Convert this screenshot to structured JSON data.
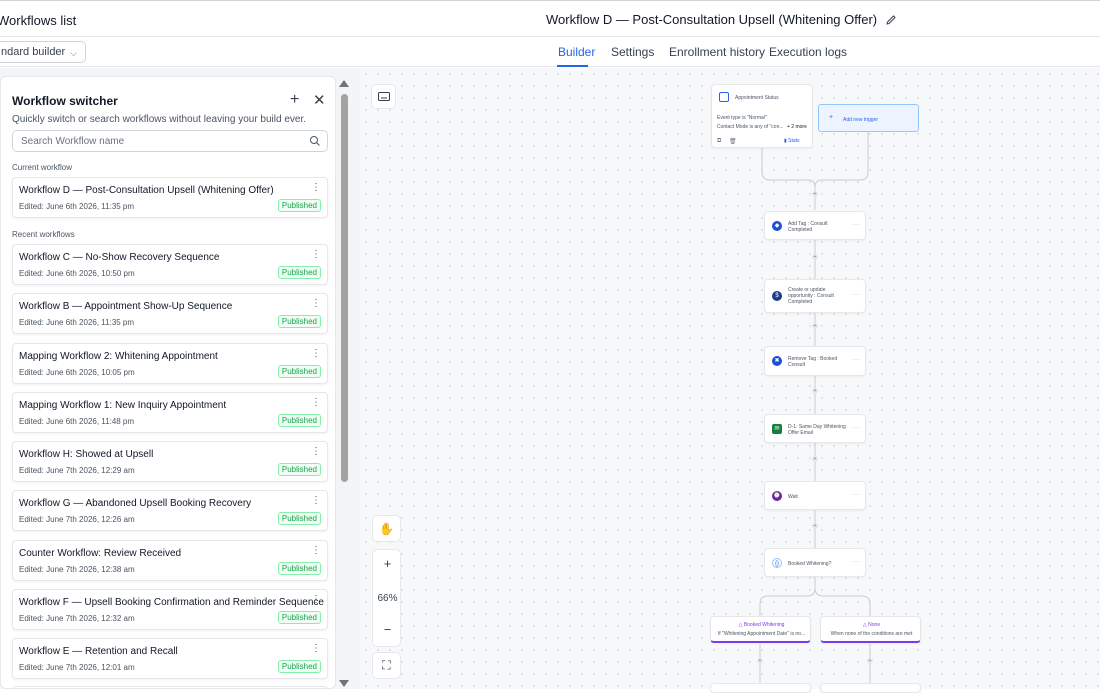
{
  "header": {
    "breadcrumb": "Workflows list",
    "title": "Workflow D — Post-Consultation Upsell (Whitening Offer)"
  },
  "builder_select": {
    "value": "ndard builder"
  },
  "tabs": [
    {
      "label": "Builder",
      "active": true
    },
    {
      "label": "Settings"
    },
    {
      "label": "Enrollment history"
    },
    {
      "label": "Execution logs"
    }
  ],
  "switcher": {
    "title": "Workflow switcher",
    "subtitle": "Quickly switch or search workflows without leaving your build ever.",
    "search_placeholder": "Search Workflow name",
    "current_label": "Current workflow",
    "recent_label": "Recent workflows",
    "current": {
      "name": "Workflow D — Post-Consultation Upsell (Whitening Offer)",
      "edited": "Edited: June 6th 2026, 11:35 pm",
      "status": "Published"
    },
    "recent": [
      {
        "name": "Workflow C — No-Show Recovery Sequence",
        "edited": "Edited: June 6th 2026, 10:50 pm",
        "status": "Published"
      },
      {
        "name": "Workflow B — Appointment Show-Up Sequence",
        "edited": "Edited: June 6th 2026, 11:35 pm",
        "status": "Published"
      },
      {
        "name": "Mapping Workflow 2: Whitening Appointment",
        "edited": "Edited: June 6th 2026, 10:05 pm",
        "status": "Published"
      },
      {
        "name": "Mapping Workflow 1: New Inquiry Appointment",
        "edited": "Edited: June 6th 2026, 11:48 pm",
        "status": "Published"
      },
      {
        "name": "Workflow H: Showed at Upsell",
        "edited": "Edited: June 7th 2026, 12:29 am",
        "status": "Published"
      },
      {
        "name": "Workflow G — Abandoned Upsell Booking Recovery",
        "edited": "Edited: June 7th 2026, 12:26 am",
        "status": "Published"
      },
      {
        "name": "Counter Workflow: Review Received",
        "edited": "Edited: June 7th 2026, 12:38 am",
        "status": "Published"
      },
      {
        "name": "Workflow F — Upsell Booking Confirmation and Reminder Sequence",
        "edited": "Edited: June 7th 2026, 12:32 am",
        "status": "Published"
      },
      {
        "name": "Workflow E — Retention and Recall",
        "edited": "Edited: June 7th 2026, 12:01 am",
        "status": "Published"
      }
    ]
  },
  "canvas": {
    "zoom": "66%",
    "trigger": {
      "title": "Appointment Status",
      "line1": "Event type is \"Normal\"",
      "line2": "Contact Mode is any of \"con...",
      "more": "+ 2 more",
      "stats": "Stats"
    },
    "add_trigger": "Add new trigger",
    "steps": [
      {
        "label": "Add Tag : Consult Completed",
        "color": "#1d4ed8"
      },
      {
        "label": "Create or update opportunity : Consult Completed",
        "color": "#1e3a8a"
      },
      {
        "label": "Remove Tag : Booked Consult",
        "color": "#1d4ed8"
      },
      {
        "label": "D-1: Same Day Whitening Offer Email",
        "color": "#15803d"
      },
      {
        "label": "Wait",
        "color": "#6b21a8"
      },
      {
        "label": "Booked Whitening?",
        "color": "#2563eb"
      }
    ],
    "branches": [
      {
        "title": "Booked Whitening",
        "desc": "If \"Whitening Appointment Date\" is no..."
      },
      {
        "title": "None",
        "desc": "When none of the conditions are met"
      }
    ]
  }
}
